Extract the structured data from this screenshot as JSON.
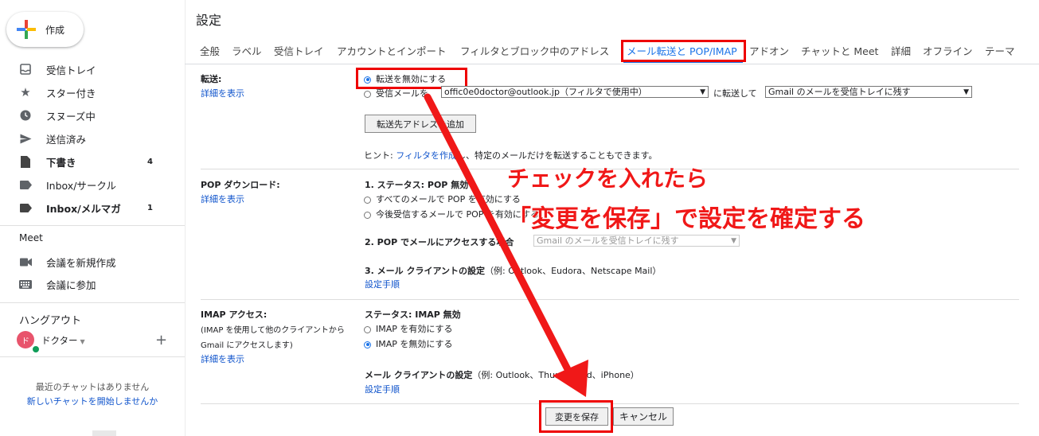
{
  "sidebar": {
    "compose_label": "作成",
    "items": [
      {
        "label": "受信トレイ",
        "icon": "inbox-icon",
        "count": "",
        "bold": false
      },
      {
        "label": "スター付き",
        "icon": "star-icon",
        "count": "",
        "bold": false
      },
      {
        "label": "スヌーズ中",
        "icon": "clock-icon",
        "count": "",
        "bold": false
      },
      {
        "label": "送信済み",
        "icon": "send-icon",
        "count": "",
        "bold": false
      },
      {
        "label": "下書き",
        "icon": "draft-icon",
        "count": "4",
        "bold": true
      },
      {
        "label": "Inbox/サークル",
        "icon": "label-icon",
        "count": "",
        "bold": false
      },
      {
        "label": "Inbox/メルマガ",
        "icon": "label-icon",
        "count": "1",
        "bold": true
      }
    ],
    "meet": {
      "heading": "Meet",
      "new_meeting": "会議を新規作成",
      "join_meeting": "会議に参加"
    },
    "hangouts": {
      "heading": "ハングアウト",
      "avatar_letter": "ド",
      "user": "ドクター",
      "no_chats": "最近のチャットはありません",
      "start_chat": "新しいチャットを開始しませんか"
    }
  },
  "settings": {
    "title": "設定",
    "tabs": [
      "全般",
      "ラベル",
      "受信トレイ",
      "アカウントとインポート",
      "フィルタとブロック中のアドレス",
      "メール転送と POP/IMAP",
      "アドオン",
      "チャットと Meet",
      "詳細",
      "オフライン",
      "テーマ"
    ],
    "active_tab": "メール転送と POP/IMAP",
    "forwarding": {
      "label": "転送:",
      "details_link": "詳細を表示",
      "disable_option": "転送を無効にする",
      "forward_prefix": "受信メールを",
      "forward_address": "offic0e0doctor@outlook.jp（フィルタで使用中）",
      "forward_middle": "に転送して",
      "forward_action": "Gmail のメールを受信トレイに残す",
      "add_address_button": "転送先アドレスを追加",
      "hint_prefix": "ヒント: ",
      "hint_link": "フィルタを作成",
      "hint_suffix": "し、特定のメールだけを転送することもできます。"
    },
    "pop": {
      "label": "POP ダウンロード:",
      "details_link": "詳細を表示",
      "status": "1. ステータス: POP 無効",
      "option_all": "すべてのメールで POP を有効にする",
      "option_new": "今後受信するメールで POP を有効にする",
      "access_label": "2. POP でメールにアクセスする場合",
      "access_value": "Gmail のメールを受信トレイに残す",
      "client_label": "3. メール クライアントの設定",
      "client_example": "（例: Outlook、Eudora、Netscape Mail）",
      "setup_link": "設定手順"
    },
    "imap": {
      "label": "IMAP アクセス:",
      "sublabel_1": "(IMAP を使用して他のクライアントから",
      "sublabel_2": "Gmail にアクセスします)",
      "details_link": "詳細を表示",
      "status": "ステータス: IMAP 無効",
      "enable_option": "IMAP を有効にする",
      "disable_option": "IMAP を無効にする",
      "client_label": "メール クライアントの設定",
      "client_example": "（例: Outlook、Thunderbird、iPhone）",
      "setup_link": "設定手順"
    },
    "save_button": "変更を保存",
    "cancel_button": "キャンセル"
  },
  "annotation": {
    "line1": "チェックを入れたら",
    "line2": "「変更を保存」で設定を確定する",
    "color": "#f01818"
  }
}
